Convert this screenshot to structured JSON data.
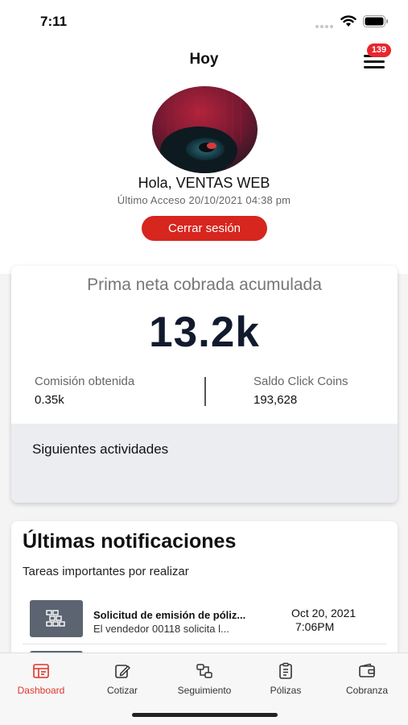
{
  "status_bar": {
    "time": "7:11"
  },
  "header": {
    "title": "Hoy",
    "notification_count": "139"
  },
  "profile": {
    "greeting": "Hola, VENTAS WEB",
    "last_access": "Último Acceso 20/10/2021 04:38 pm",
    "logout_label": "Cerrar sesión"
  },
  "stats": {
    "title": "Prima neta cobrada acumulada",
    "value": "13.2k",
    "commission_label": "Comisión obtenida",
    "commission_value": "0.35k",
    "coins_label": "Saldo Click Coins",
    "coins_value": "193,628",
    "activities_label": "Siguientes actividades"
  },
  "notifications": {
    "title": "Últimas notificaciones",
    "subtitle": "Tareas importantes por realizar",
    "items": [
      {
        "title": "Solicitud de emisión de póliz...",
        "body": "El vendedor 00118 solicita l...",
        "date": "Oct 20, 2021",
        "time": "7:06PM"
      }
    ]
  },
  "tabs": [
    {
      "label": "Dashboard",
      "icon": "dashboard-icon",
      "active": true
    },
    {
      "label": "Cotizar",
      "icon": "edit-icon",
      "active": false
    },
    {
      "label": "Seguimiento",
      "icon": "tracking-icon",
      "active": false
    },
    {
      "label": "Pólizas",
      "icon": "policy-icon",
      "active": false
    },
    {
      "label": "Cobranza",
      "icon": "wallet-icon",
      "active": false
    }
  ],
  "colors": {
    "accent": "#d6261e",
    "badge": "#e8262e",
    "dark_value": "#121a2e",
    "panel_gray": "#ebedf0",
    "icon_box": "#5b6470"
  }
}
